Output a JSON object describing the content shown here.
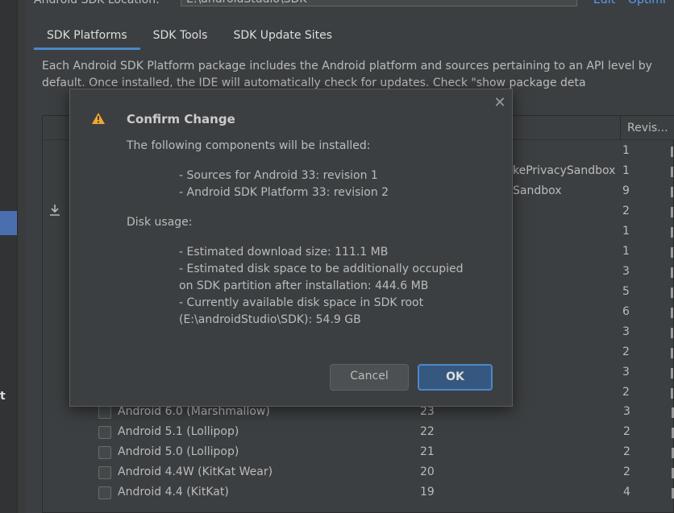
{
  "sdk_location": {
    "label": "Android SDK Location:",
    "value": "E:\\androidStudio\\SDK",
    "edit_link": "Edit",
    "optimize_link": "Optimi"
  },
  "tabs": [
    {
      "label": "SDK Platforms",
      "active": true
    },
    {
      "label": "SDK Tools",
      "active": false
    },
    {
      "label": "SDK Update Sites",
      "active": false
    }
  ],
  "description": "Each Android SDK Platform package includes the Android platform and sources pertaining to an API level by default. Once installed, the IDE will automatically check for updates. Check \"show package deta",
  "table": {
    "rev_header": "Revis...",
    "behind_fragments": [
      "kePrivacySandbox",
      "Sandbox"
    ],
    "hidden_revisions": [
      "1",
      "1",
      "9",
      "2",
      "1",
      "1",
      "3",
      "5",
      "6",
      "3",
      "2",
      "3",
      "2"
    ],
    "rows": [
      {
        "name": "Android 6.0 (Marshmallow)",
        "api": "23",
        "rev": "3"
      },
      {
        "name": "Android 5.1 (Lollipop)",
        "api": "22",
        "rev": "2"
      },
      {
        "name": "Android 5.0 (Lollipop)",
        "api": "21",
        "rev": "2"
      },
      {
        "name": "Android 4.4W (KitKat Wear)",
        "api": "20",
        "rev": "2"
      },
      {
        "name": "Android 4.4 (KitKat)",
        "api": "19",
        "rev": "4"
      }
    ]
  },
  "dialog": {
    "title": "Confirm Change",
    "intro": "The following components will be installed:",
    "components": [
      "- Sources for Android 33: revision 1",
      "- Android SDK Platform 33: revision 2"
    ],
    "disk_usage_label": "Disk usage:",
    "disk_lines": [
      "- Estimated download size: 111.1 MB",
      "- Estimated disk space to be additionally occupied",
      "on SDK partition after installation: 444.6 MB",
      "- Currently available disk space in SDK root",
      "(E:\\androidStudio\\SDK): 54.9 GB"
    ],
    "cancel_label": "Cancel",
    "ok_label": "OK",
    "close_glyph": "✕"
  },
  "left_fragment": "t",
  "colors": {
    "background": "#3c3f41",
    "accent": "#4a88c7",
    "link": "#589df6",
    "warning": "#f0a732"
  }
}
